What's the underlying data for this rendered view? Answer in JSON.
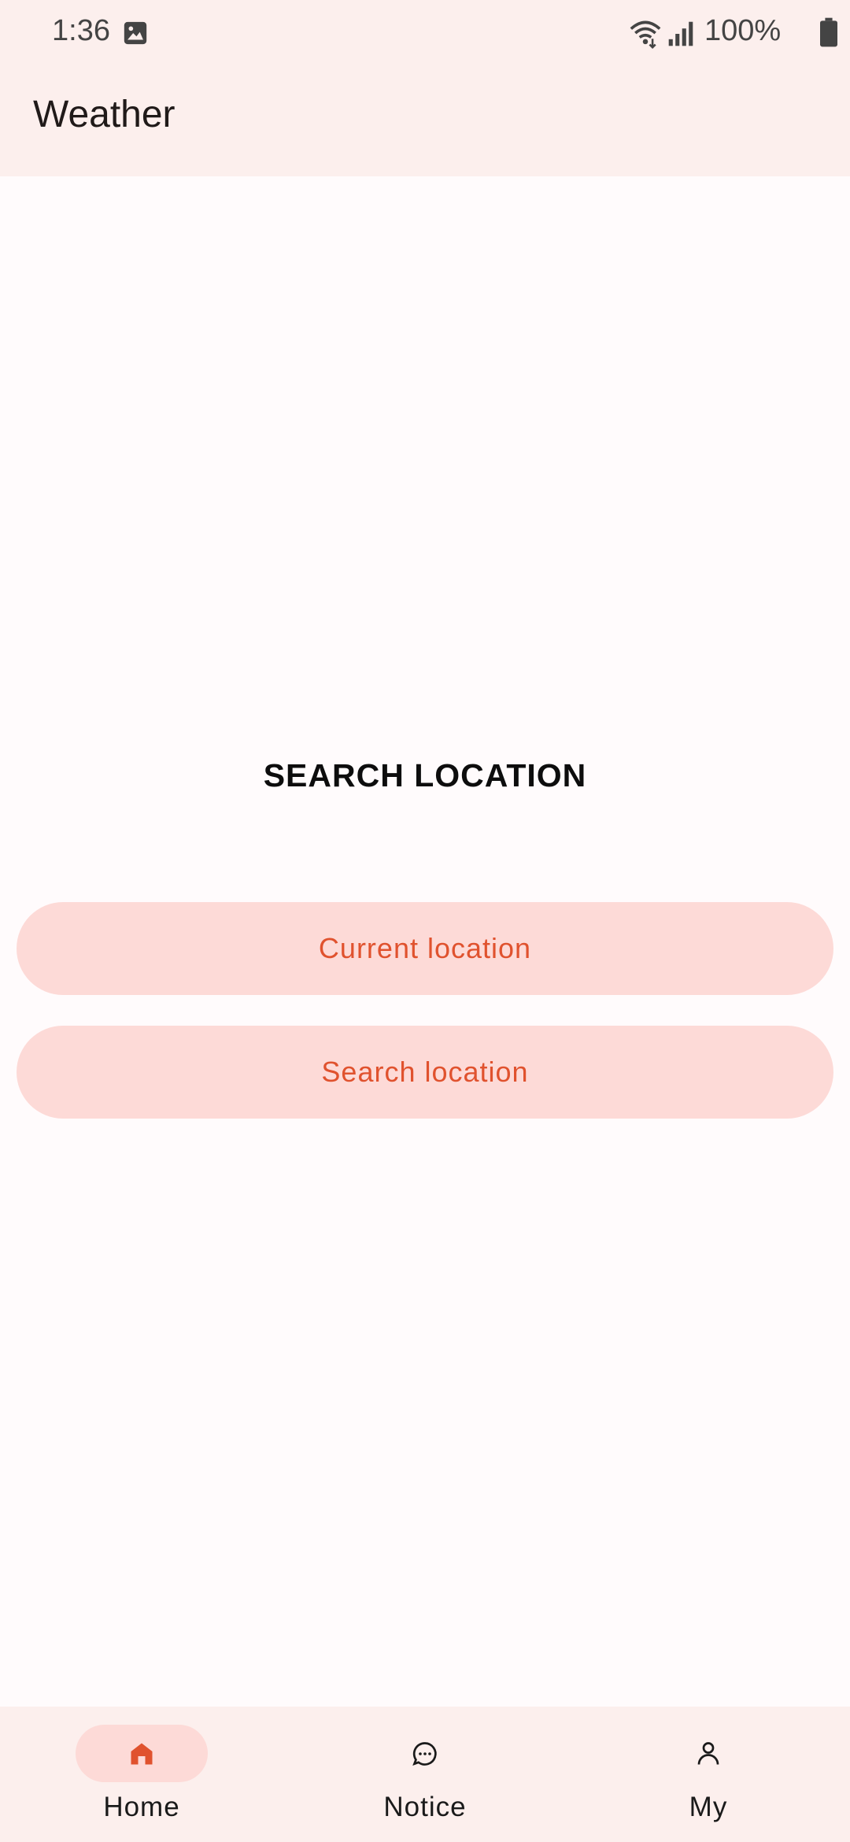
{
  "status": {
    "time": "1:36",
    "battery": "100%",
    "icons": [
      "image-icon",
      "wifi-icon",
      "signal-icon",
      "battery-icon"
    ]
  },
  "app_bar": {
    "title": "Weather"
  },
  "main": {
    "heading": "SEARCH LOCATION",
    "buttons": {
      "current": "Current location",
      "search": "Search location"
    }
  },
  "bottom_nav": {
    "items": [
      {
        "label": "Home",
        "icon": "home-icon",
        "active": true
      },
      {
        "label": "Notice",
        "icon": "chat-bubble-icon",
        "active": false
      },
      {
        "label": "My",
        "icon": "person-icon",
        "active": false
      }
    ]
  },
  "colors": {
    "accent": "#e0522e",
    "button_bg": "#fddad7",
    "bar_bg": "#fcefed",
    "page_bg": "#fffbfc"
  }
}
